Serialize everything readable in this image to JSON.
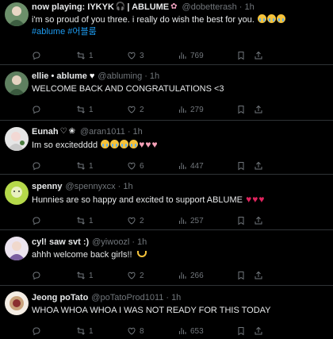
{
  "tweets": [
    {
      "name": "now playing: IYKYK",
      "name_suffix": "| ABLUME",
      "handle": "@dobetterash",
      "time": "1h",
      "text": "i'm so proud of you three. i really do wish the best for you.",
      "hashtags": "#ablume #어블룸",
      "reply": "",
      "retweets": "1",
      "likes": "3",
      "views": "769",
      "avatar_color": "#6c8f6a"
    },
    {
      "name": "ellie • ablume",
      "handle": "@abluming",
      "time": "1h",
      "text": "WELCOME BACK AND CONGRATULATIONS <3",
      "reply": "",
      "retweets": "1",
      "likes": "2",
      "views": "279",
      "avatar_color": "#5f8060"
    },
    {
      "name": "Eunah",
      "handle": "@aran1011",
      "time": "1h",
      "text": "Im so excitedddd",
      "reply": "",
      "retweets": "1",
      "likes": "6",
      "views": "447",
      "avatar_color": "#d9d9d9"
    },
    {
      "name": "spenny",
      "handle": "@spennyxcx",
      "time": "1h",
      "text": "Hunnies are so happy and excited to support ABLUME",
      "reply": "",
      "retweets": "1",
      "likes": "2",
      "views": "257",
      "avatar_color": "#b5d94a"
    },
    {
      "name": "cyl! saw svt :)",
      "handle": "@yiwoozl",
      "time": "1h",
      "text": "ahhh welcome back girls!!",
      "reply": "",
      "retweets": "1",
      "likes": "2",
      "views": "266",
      "avatar_color": "#e8e0ec"
    },
    {
      "name": "Jeong poTato",
      "handle": "@poTatoProd1011",
      "time": "1h",
      "text": "WHOA WHOA WHOA I WAS NOT READY FOR THIS TODAY",
      "reply": "",
      "retweets": "1",
      "likes": "8",
      "views": "653",
      "avatar_color": "#c9b6a0"
    }
  ]
}
